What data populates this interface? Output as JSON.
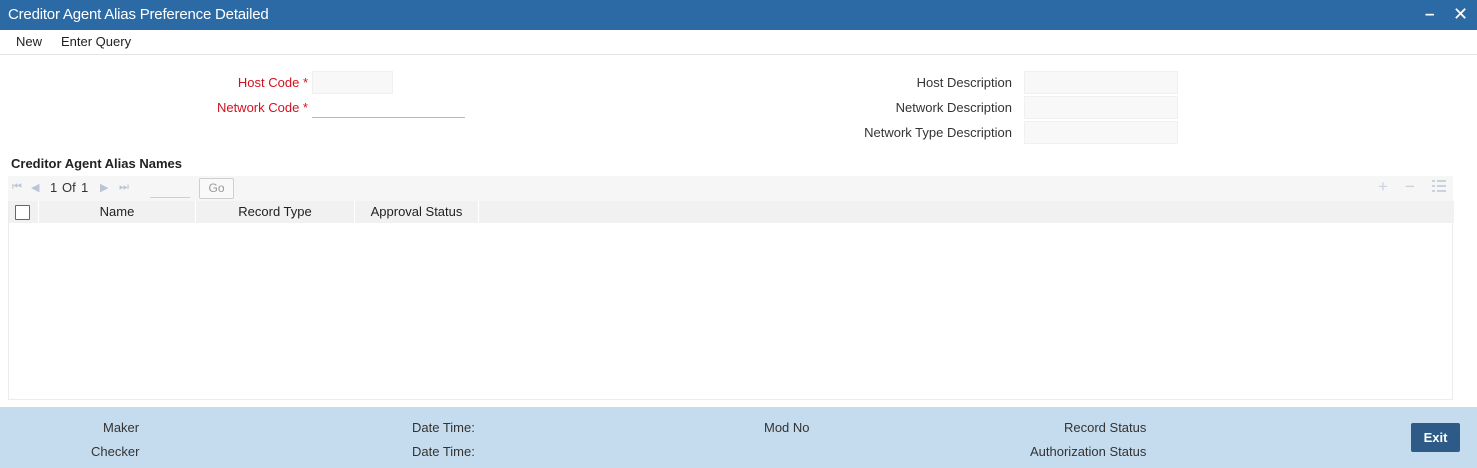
{
  "window": {
    "title": "Creditor Agent Alias Preference Detailed",
    "minimize_glyph": "–",
    "close_glyph": "✕"
  },
  "menu": {
    "new_label": "New",
    "enter_query_label": "Enter Query"
  },
  "form": {
    "host_code_label": "Host Code *",
    "host_code_value": "",
    "network_code_label": "Network Code *",
    "network_code_value": "",
    "host_description_label": "Host Description",
    "host_description_value": "",
    "network_description_label": "Network Description",
    "network_description_value": "",
    "network_type_description_label": "Network Type Description",
    "network_type_description_value": ""
  },
  "alias_section": {
    "title": "Creditor Agent Alias Names",
    "pager": {
      "current_page": "1",
      "of_label": "Of",
      "total_pages": "1",
      "go_label": "Go",
      "page_input_value": ""
    },
    "columns": [
      "Name",
      "Record Type",
      "Approval Status"
    ],
    "rows": []
  },
  "footer": {
    "maker_label": "Maker",
    "checker_label": "Checker",
    "maker_date_time_label": "Date Time:",
    "checker_date_time_label": "Date Time:",
    "mod_no_label": "Mod No",
    "record_status_label": "Record Status",
    "authorization_status_label": "Authorization Status",
    "exit_label": "Exit"
  },
  "icons": {
    "first_page": "first-page-icon",
    "prev_page": "previous-page-icon",
    "next_page": "next-page-icon",
    "last_page": "last-page-icon",
    "add_row": "add-row-icon",
    "delete_row": "delete-row-icon",
    "single_view": "single-record-view-icon"
  },
  "colors": {
    "title_bar": "#2c6aa6",
    "required_label": "#d4101e",
    "footer": "#c5dcef",
    "exit_button": "#2d5a86"
  }
}
